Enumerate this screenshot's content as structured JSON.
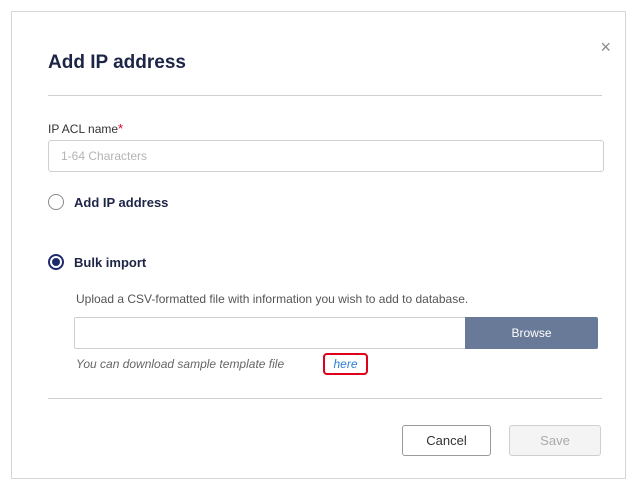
{
  "dialog": {
    "title": "Add IP address",
    "close_glyph": "×",
    "acl_name": {
      "label": "IP ACL name",
      "required_mark": "*",
      "placeholder": "1-64 Characters",
      "value": ""
    },
    "options": [
      {
        "label": "Add IP address",
        "selected": false
      },
      {
        "label": "Bulk import",
        "selected": true
      }
    ],
    "bulk_import": {
      "description": "Upload a CSV-formatted file with information you wish to add to database.",
      "browse_label": "Browse",
      "sample_text": "You can download sample template file",
      "sample_link_label": "here"
    },
    "buttons": {
      "cancel": "Cancel",
      "save": "Save"
    }
  },
  "colors": {
    "title": "#1d2546",
    "radio_checked": "#1d2b6b",
    "browse_bg": "#687a98",
    "link": "#2b7fd6",
    "highlight": "#e0001b",
    "required": "#e0001b"
  },
  "icons": {
    "close": "close-icon",
    "radio_unchecked": "radio-unchecked",
    "radio_checked": "radio-checked"
  }
}
